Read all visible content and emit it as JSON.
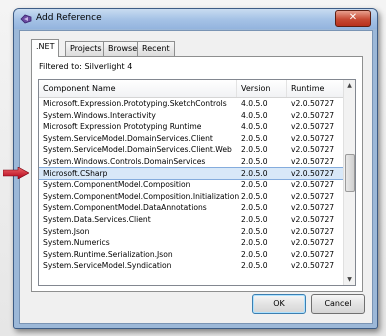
{
  "window": {
    "title": "Add Reference",
    "close_glyph": "✕"
  },
  "tabs": [
    {
      "label": ".NET",
      "active": true
    },
    {
      "label": "Projects"
    },
    {
      "label": "Browse"
    },
    {
      "label": "Recent"
    }
  ],
  "filter_text": "Filtered to: Silverlight 4",
  "columns": {
    "name": "Component Name",
    "version": "Version",
    "runtime": "Runtime"
  },
  "rows": [
    {
      "name": "Microsoft.Expression.Prototyping.SketchControls",
      "version": "4.0.5.0",
      "runtime": "v2.0.50727"
    },
    {
      "name": "System.Windows.Interactivity",
      "version": "4.0.5.0",
      "runtime": "v2.0.50727"
    },
    {
      "name": "Microsoft Expression Prototyping Runtime",
      "version": "4.0.5.0",
      "runtime": "v2.0.50727"
    },
    {
      "name": "System.ServiceModel.DomainServices.Client",
      "version": "2.0.5.0",
      "runtime": "v2.0.50727"
    },
    {
      "name": "System.ServiceModel.DomainServices.Client.Web",
      "version": "2.0.5.0",
      "runtime": "v2.0.50727"
    },
    {
      "name": "System.Windows.Controls.DomainServices",
      "version": "2.0.5.0",
      "runtime": "v2.0.50727"
    },
    {
      "name": "Microsoft.CSharp",
      "version": "2.0.5.0",
      "runtime": "v2.0.50727",
      "selected": true
    },
    {
      "name": "System.ComponentModel.Composition",
      "version": "2.0.5.0",
      "runtime": "v2.0.50727"
    },
    {
      "name": "System.ComponentModel.Composition.Initialization",
      "version": "2.0.5.0",
      "runtime": "v2.0.50727"
    },
    {
      "name": "System.ComponentModel.DataAnnotations",
      "version": "2.0.5.0",
      "runtime": "v2.0.50727"
    },
    {
      "name": "System.Data.Services.Client",
      "version": "2.0.5.0",
      "runtime": "v2.0.50727"
    },
    {
      "name": "System.Json",
      "version": "2.0.5.0",
      "runtime": "v2.0.50727"
    },
    {
      "name": "System.Numerics",
      "version": "2.0.5.0",
      "runtime": "v2.0.50727"
    },
    {
      "name": "System.Runtime.Serialization.Json",
      "version": "2.0.5.0",
      "runtime": "v2.0.50727"
    },
    {
      "name": "System.ServiceModel.Syndication",
      "version": "2.0.5.0",
      "runtime": "v2.0.50727"
    }
  ],
  "buttons": {
    "ok": "OK",
    "cancel": "Cancel"
  },
  "colors": {
    "pointer_arrow": "#c8102e",
    "selection": "#d8e8f8"
  }
}
